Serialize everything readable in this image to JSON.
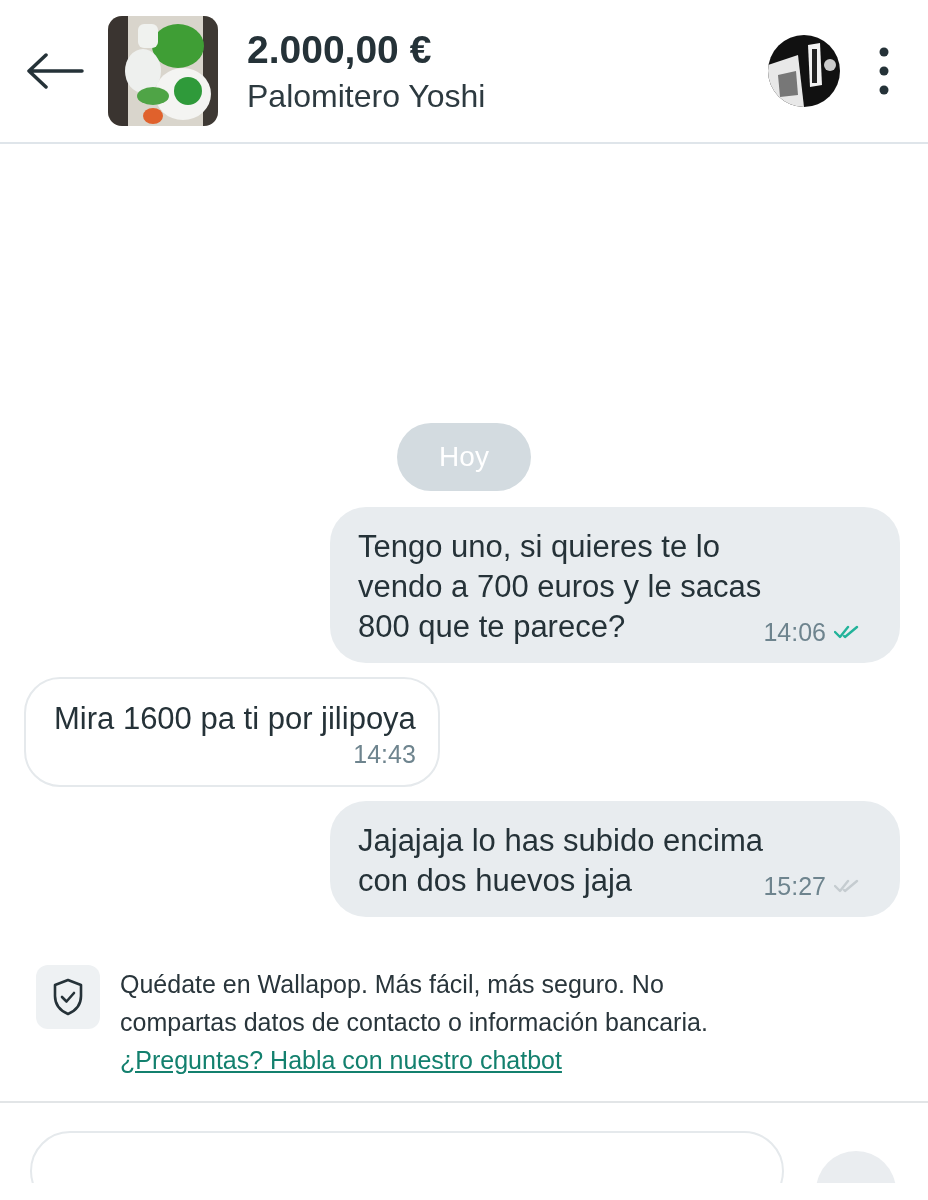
{
  "header": {
    "price": "2.000,00 €",
    "title": "Palomitero Yoshi"
  },
  "date_divider": "Hoy",
  "messages": [
    {
      "kind": "outgoing",
      "text": "Tengo uno, si quieres te lo\nvendo a 700 euros y le sacas\n800 que te parece?",
      "time": "14:06",
      "read": true
    },
    {
      "kind": "incoming",
      "text": "Mira 1600 pa ti por jilipoya",
      "time": "14:43"
    },
    {
      "kind": "outgoing",
      "text": "Jajajaja lo has subido encima\ncon dos huevos jaja",
      "time": "15:27",
      "read": false
    }
  ],
  "safety_notice": {
    "text": "Quédate en Wallapop. Más fácil, más seguro. No\ncompartas datos de contacto o información bancaria.",
    "link": "¿Preguntas? Habla con nuestro chatbot"
  }
}
